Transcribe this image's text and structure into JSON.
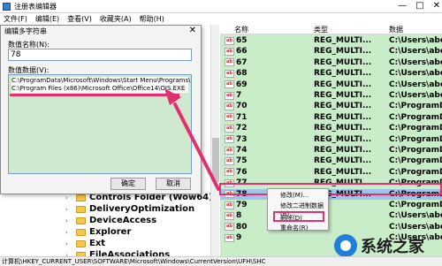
{
  "window": {
    "title": "注册表编辑器",
    "minimize": "—",
    "maximize": "□",
    "close": "✕"
  },
  "menu": [
    "文件(F)",
    "编辑(E)",
    "查看(V)",
    "收藏夹(A)",
    "帮助(H)"
  ],
  "dialog": {
    "title": "编辑多字符串",
    "close": "✕",
    "name_label": "数值名称(N):",
    "name_value": "78",
    "data_label": "数值数据(V):",
    "data_line1": "C:\\ProgramData\\Microsoft\\Windows\\Start Menu\\Programs\\M",
    "data_line2": "C:\\Program Files (x86)\\Microsoft Office\\Office14\\OIS.EXE",
    "ok": "确定",
    "cancel": "取消"
  },
  "tree": [
    {
      "label": "Controls Folder (Wow64)"
    },
    {
      "label": "DeliveryOptimization"
    },
    {
      "label": "DeviceAccess"
    },
    {
      "label": "Explorer"
    },
    {
      "label": "Ext"
    },
    {
      "label": "FileAssociations"
    }
  ],
  "columns": {
    "name": "名称",
    "type": "类型",
    "data": "数据"
  },
  "rows": [
    {
      "name": "65",
      "type": "REG_MULTI...",
      "data": "C:\\Users\\abcde\\App"
    },
    {
      "name": "66",
      "type": "REG_MULTI...",
      "data": "C:\\Users\\abcde\\App"
    },
    {
      "name": "67",
      "type": "REG_MULTI...",
      "data": "C:\\Users\\abcde\\App"
    },
    {
      "name": "68",
      "type": "REG_MULTI...",
      "data": "C:\\Users\\abcde\\App"
    },
    {
      "name": "69",
      "type": "REG_MULTI...",
      "data": "C:\\Users\\abcde\\App"
    },
    {
      "name": "7",
      "type": "REG_MULTI...",
      "data": "C:\\Users\\abcde\\App"
    },
    {
      "name": "70",
      "type": "REG_MULTI...",
      "data": "C:\\ProgramData\\Mi"
    },
    {
      "name": "71",
      "type": "REG_MULTI...",
      "data": "C:\\ProgramData\\Mi"
    },
    {
      "name": "72",
      "type": "REG_MULTI...",
      "data": "C:\\ProgramData\\Mi"
    },
    {
      "name": "73",
      "type": "REG_MULTI...",
      "data": "C:\\ProgramData\\Mi"
    },
    {
      "name": "74",
      "type": "REG_MULTI...",
      "data": "C:\\ProgramData\\Mi"
    },
    {
      "name": "75",
      "type": "REG_MULTI...",
      "data": "C:\\ProgramData\\Mi"
    },
    {
      "name": "76",
      "type": "REG_MULTI...",
      "data": "C:\\ProgramData\\Mi"
    },
    {
      "name": "77",
      "type": "REG_MULTI...",
      "data": "C:\\ProgramData\\Mi"
    },
    {
      "name": "78",
      "type": "REG_MULTI...",
      "data": "C:\\ProgramData\\Mi",
      "selected": true
    },
    {
      "name": "79",
      "type": "",
      "data": "C:\\ProgramData\\Mi"
    },
    {
      "name": "8",
      "type": "",
      "data": "C:\\Users\\abcde\\App"
    },
    {
      "name": "80",
      "type": "",
      "data": "C:\\Users\\abcde\\App"
    },
    {
      "name": "9",
      "type": "",
      "data": "C:\\Users\\abcde\\App"
    }
  ],
  "context_menu": {
    "modify": "修改(M)...",
    "modify_binary": "修改二进制数据(B)...",
    "delete": "删除(D)",
    "rename": "重命名(R)"
  },
  "status": "计算机\\HKEY_CURRENT_USER\\SOFTWARE\\Microsoft\\Windows\\CurrentVersion\\UFH\\SHC",
  "watermark": {
    "text": "系统之家"
  },
  "colors": {
    "highlight": "#e0306f",
    "selected_row": "#9ec4ea",
    "pane_bg": "#c9ecc9"
  }
}
